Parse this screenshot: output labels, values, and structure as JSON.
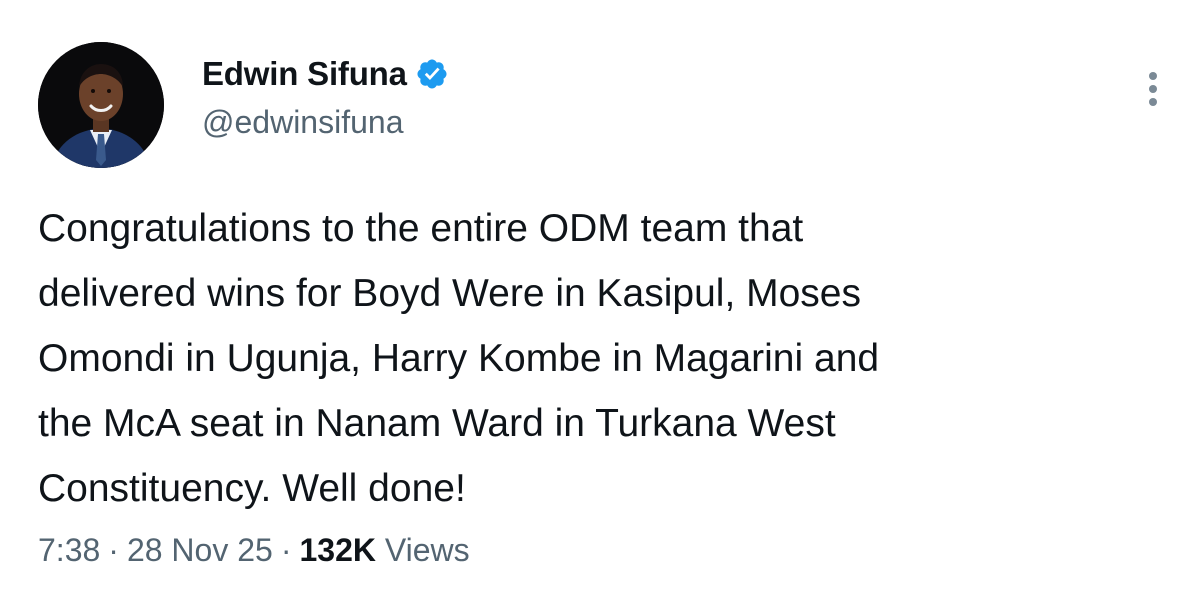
{
  "author": {
    "display_name": "Edwin Sifuna",
    "handle": "@edwinsifuna",
    "verified": true
  },
  "tweet": {
    "lines": [
      "Congratulations to the entire ODM team that",
      "delivered wins for Boyd Were in Kasipul, Moses",
      "Omondi in Ugunja, Harry Kombe in Magarini and",
      "the McA seat in Nanam Ward in Turkana West",
      "Constituency. Well done!"
    ]
  },
  "meta": {
    "time": "7:38",
    "separator": "·",
    "date": "28 Nov 25",
    "views_count": "132K",
    "views_label": "Views"
  },
  "icons": {
    "verified": "verified-badge-icon",
    "more": "more-vertical-icon"
  },
  "colors": {
    "verified_blue": "#1d9bf0",
    "secondary_text": "#536471",
    "primary_text": "#0f1419"
  }
}
